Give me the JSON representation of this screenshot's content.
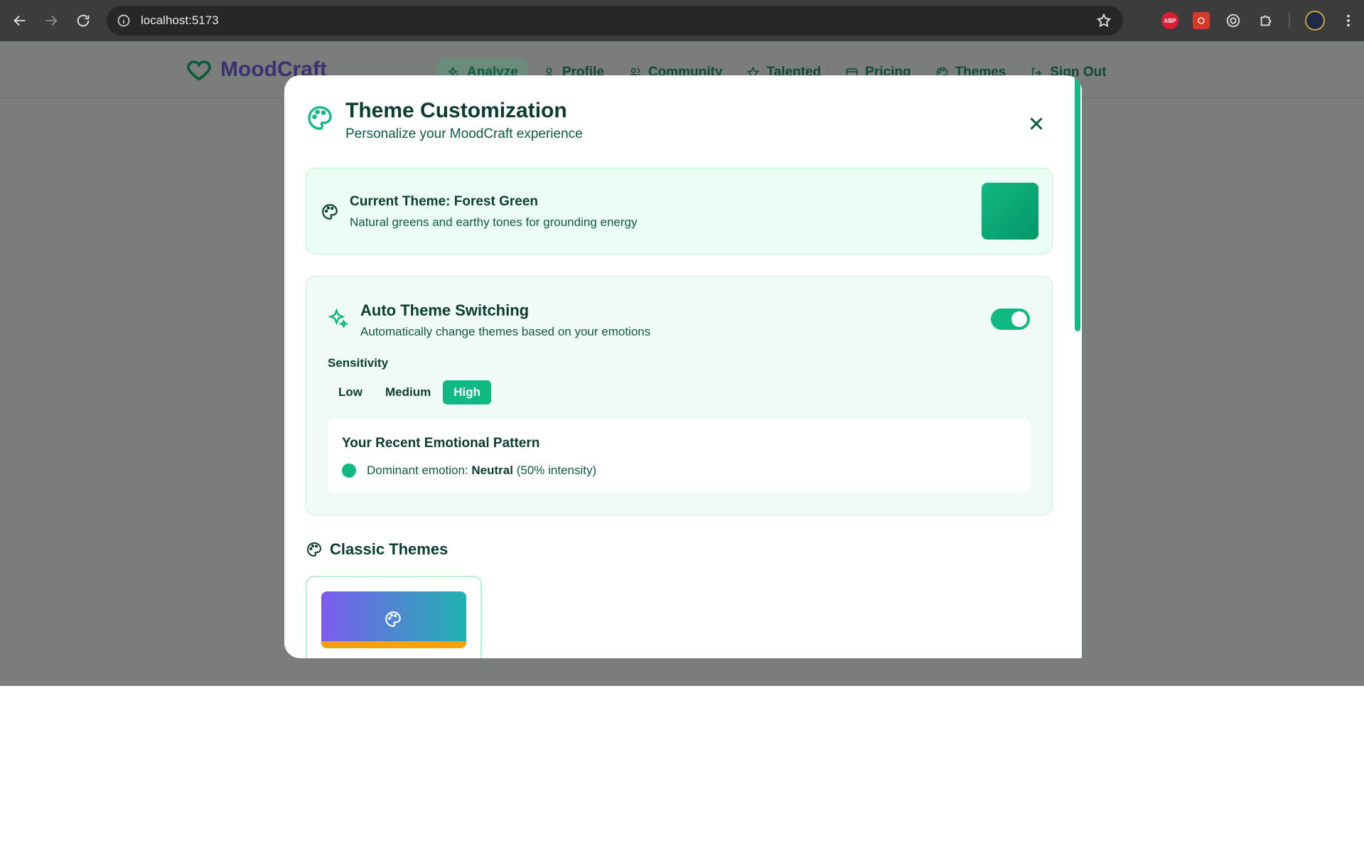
{
  "browser": {
    "url": "localhost:5173",
    "abp_label": "ABP"
  },
  "app": {
    "brand": "MoodCraft",
    "nav": [
      {
        "label": "Analyze",
        "icon": "sparkles-icon"
      },
      {
        "label": "Profile",
        "icon": "user-icon"
      },
      {
        "label": "Community",
        "icon": "users-icon"
      },
      {
        "label": "Talented",
        "icon": "star-icon"
      },
      {
        "label": "Pricing",
        "icon": "credit-card-icon"
      },
      {
        "label": "Themes",
        "icon": "palette-icon"
      },
      {
        "label": "Sign Out",
        "icon": "log-out-icon"
      }
    ]
  },
  "modal": {
    "title": "Theme Customization",
    "subtitle": "Personalize your MoodCraft experience",
    "current": {
      "title": "Current Theme: Forest Green",
      "description": "Natural greens and earthy tones for grounding energy",
      "swatch_color": "#10b981"
    },
    "auto": {
      "title": "Auto Theme Switching",
      "description": "Automatically change themes based on your emotions",
      "enabled": true,
      "sensitivity_label": "Sensitivity",
      "sensitivity_options": [
        "Low",
        "Medium",
        "High"
      ],
      "sensitivity_selected": "High",
      "pattern_title": "Your Recent Emotional Pattern",
      "pattern_prefix": "Dominant emotion: ",
      "pattern_emotion": "Neutral",
      "pattern_suffix": " (50% intensity)"
    },
    "classic_title": "Classic Themes"
  },
  "colors": {
    "accent": "#10b981",
    "text_dark": "#0b3d2e"
  }
}
